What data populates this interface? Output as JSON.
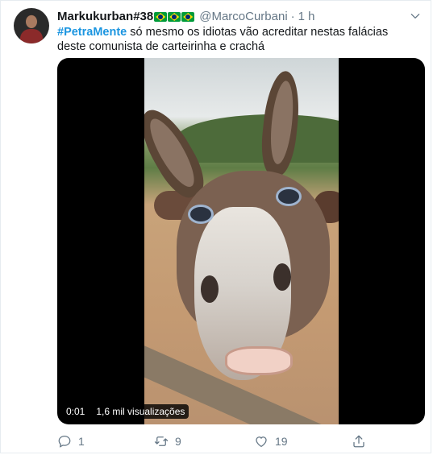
{
  "tweet": {
    "display_name": "Markukurban#38",
    "handle": "@MarcoCurbani",
    "separator": "·",
    "time": "1 h",
    "hashtag": "#PetraMente",
    "text": " só mesmo os idiotas vão acreditar nestas falácias deste comunista de carteirinha e crachá",
    "flags": [
      "brazil-flag",
      "brazil-flag",
      "brazil-flag"
    ]
  },
  "video": {
    "timestamp": "0:01",
    "views": "1,6 mil visualizações"
  },
  "actions": {
    "reply_count": "1",
    "retweet_count": "9",
    "like_count": "19"
  },
  "colors": {
    "link": "#1b95e0",
    "secondary_text": "#657786",
    "border": "#e6ecf0"
  }
}
